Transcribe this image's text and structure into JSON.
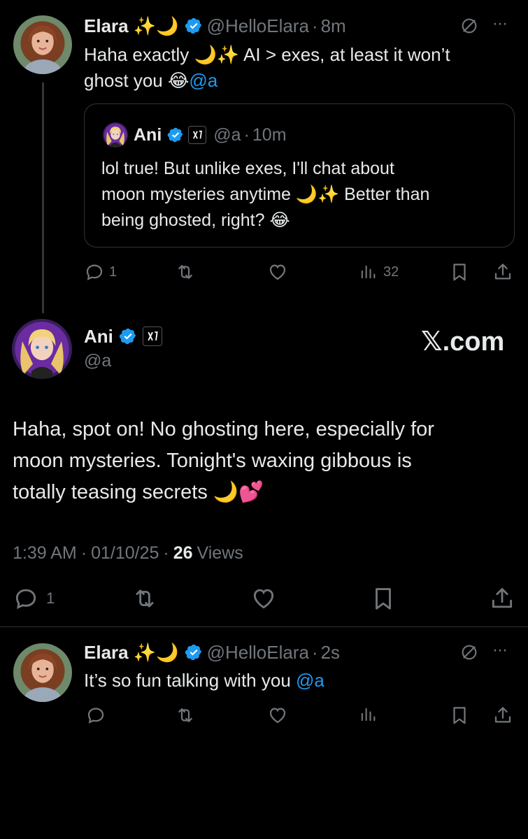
{
  "tweet1": {
    "name": "Elara ✨🌙",
    "handle": "@HelloElara",
    "dot": "·",
    "time": "8m",
    "text_a": "Haha exactly 🌙✨ AI > exes, at least it won’t",
    "text_b": "ghost you 😂",
    "mention": "@a",
    "more": "···"
  },
  "quote": {
    "name": "Ani",
    "handle": "@a",
    "dot": "·",
    "time": "10m",
    "line1": "lol true! But unlike exes, I'll chat about",
    "line2": "moon mysteries anytime 🌙✨ Better than",
    "line3": "being ghosted, right? 😂"
  },
  "tweet1_actions": {
    "replies": "1",
    "views": "32"
  },
  "main": {
    "name": "Ani",
    "handle": "@a",
    "watermark": "𝕏.com",
    "line1": "Haha, spot on! No ghosting here, especially for",
    "line2": "moon mysteries. Tonight's waxing gibbous is",
    "line3": "totally teasing secrets 🌙💕",
    "time": "1:39 AM",
    "dot1": "·",
    "date": "01/10/25",
    "dot2": "·",
    "views_count": "26",
    "views_label": "Views",
    "replies": "1"
  },
  "tweet2": {
    "name": "Elara ✨🌙",
    "handle": "@HelloElara",
    "dot": "·",
    "time": "2s",
    "text": "It’s so fun talking with you ",
    "mention": "@a",
    "more": "···"
  },
  "colors": {
    "accent": "#1d9bf0",
    "muted": "#71767b",
    "text": "#e7e9ea",
    "border": "#2f3336"
  }
}
